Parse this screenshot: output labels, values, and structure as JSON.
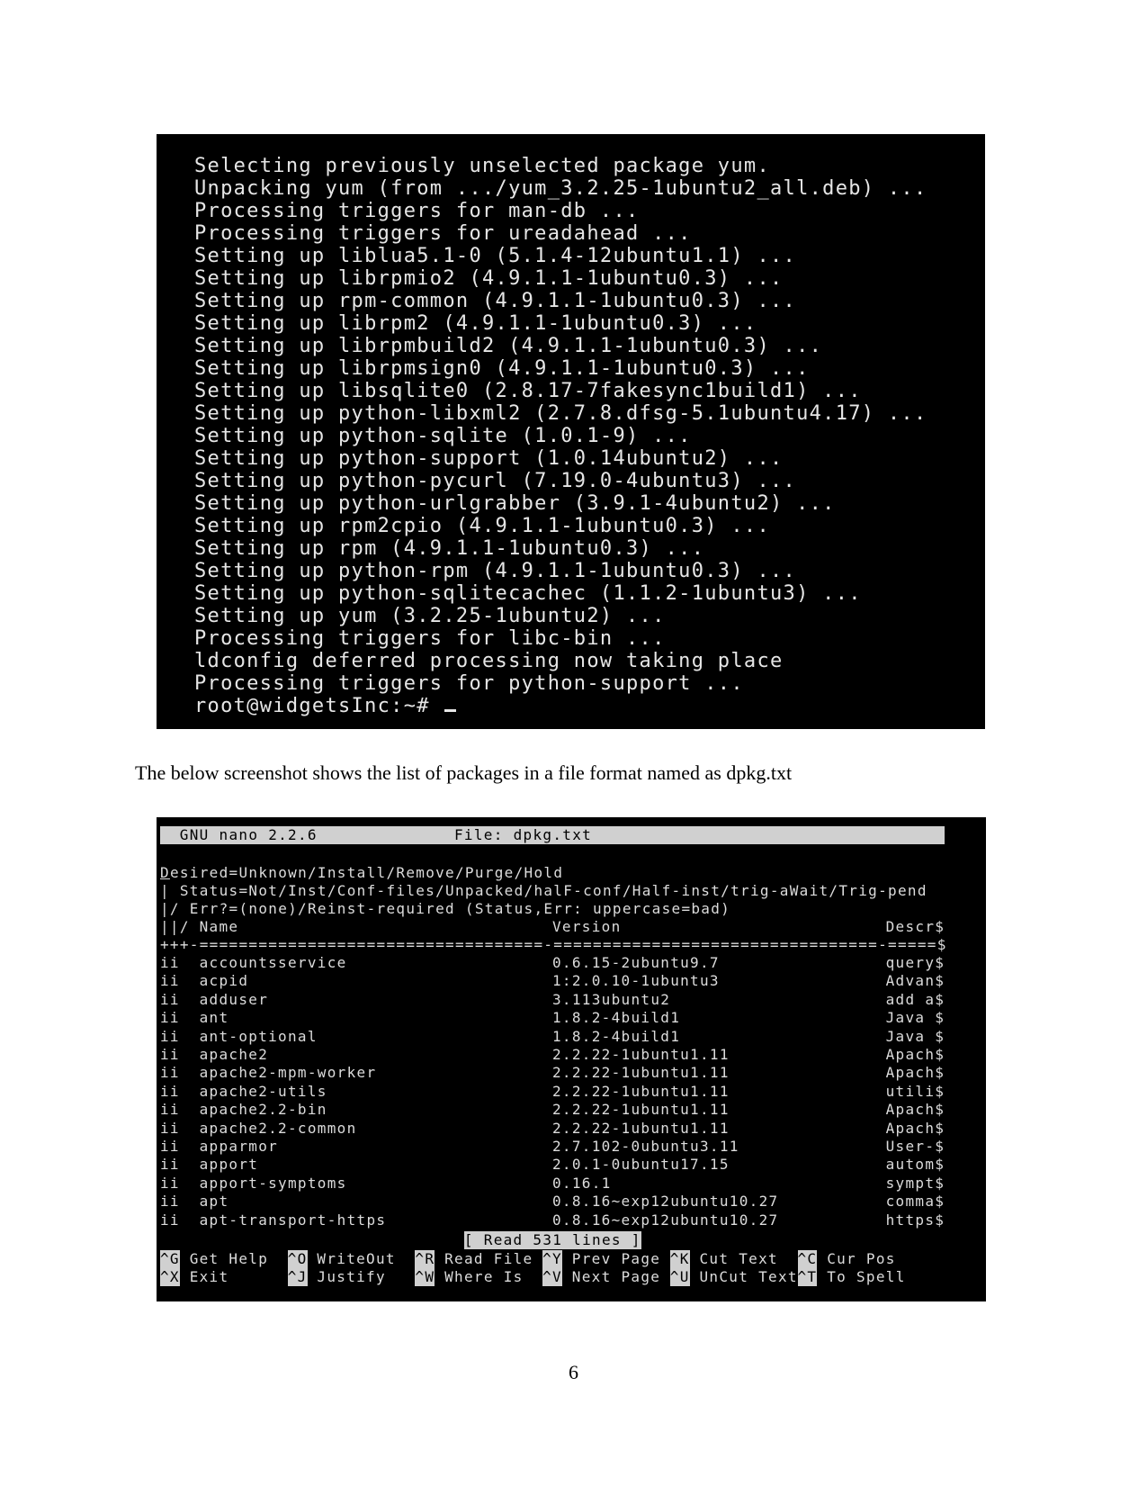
{
  "terminal_output": {
    "lines": [
      "Selecting previously unselected package yum.",
      "Unpacking yum (from .../yum_3.2.25-1ubuntu2_all.deb) ...",
      "Processing triggers for man-db ...",
      "Processing triggers for ureadahead ...",
      "Setting up liblua5.1-0 (5.1.4-12ubuntu1.1) ...",
      "Setting up librpmio2 (4.9.1.1-1ubuntu0.3) ...",
      "Setting up rpm-common (4.9.1.1-1ubuntu0.3) ...",
      "Setting up librpm2 (4.9.1.1-1ubuntu0.3) ...",
      "Setting up librpmbuild2 (4.9.1.1-1ubuntu0.3) ...",
      "Setting up librpmsign0 (4.9.1.1-1ubuntu0.3) ...",
      "Setting up libsqlite0 (2.8.17-7fakesync1build1) ...",
      "Setting up python-libxml2 (2.7.8.dfsg-5.1ubuntu4.17) ...",
      "Setting up python-sqlite (1.0.1-9) ...",
      "Setting up python-support (1.0.14ubuntu2) ...",
      "Setting up python-pycurl (7.19.0-4ubuntu3) ...",
      "Setting up python-urlgrabber (3.9.1-4ubuntu2) ...",
      "Setting up rpm2cpio (4.9.1.1-1ubuntu0.3) ...",
      "Setting up rpm (4.9.1.1-1ubuntu0.3) ...",
      "Setting up python-rpm (4.9.1.1-1ubuntu0.3) ...",
      "Setting up python-sqlitecachec (1.1.2-1ubuntu3) ...",
      "Setting up yum (3.2.25-1ubuntu2) ...",
      "Processing triggers for libc-bin ...",
      "ldconfig deferred processing now taking place",
      "Processing triggers for python-support ..."
    ],
    "prompt": "root@widgetsInc:~# "
  },
  "paragraph": "The below screenshot shows the list of packages in a file format named as dpkg.txt",
  "nano": {
    "app_version": "GNU nano 2.2.6",
    "file_label": "File: dpkg.txt",
    "header": {
      "desired_first": "D",
      "desired_rest": "esired=Unknown/Install/Remove/Purge/Hold",
      "status": "| Status=Not/Inst/Conf-files/Unpacked/halF-conf/Half-inst/trig-aWait/Trig-pend",
      "err": "|/ Err?=(none)/Reinst-required (Status,Err: uppercase=bad)",
      "col_prefix": "||/",
      "col_name": "Name",
      "col_version": "Version",
      "col_descr": "Descr$",
      "separator": "+++-===================================-=================================-=====$"
    },
    "packages": [
      {
        "status": "ii",
        "name": "accountsservice",
        "version": "0.6.15-2ubuntu9.7",
        "descr": "query$"
      },
      {
        "status": "ii",
        "name": "acpid",
        "version": "1:2.0.10-1ubuntu3",
        "descr": "Advan$"
      },
      {
        "status": "ii",
        "name": "adduser",
        "version": "3.113ubuntu2",
        "descr": "add a$"
      },
      {
        "status": "ii",
        "name": "ant",
        "version": "1.8.2-4build1",
        "descr": "Java $"
      },
      {
        "status": "ii",
        "name": "ant-optional",
        "version": "1.8.2-4build1",
        "descr": "Java $"
      },
      {
        "status": "ii",
        "name": "apache2",
        "version": "2.2.22-1ubuntu1.11",
        "descr": "Apach$"
      },
      {
        "status": "ii",
        "name": "apache2-mpm-worker",
        "version": "2.2.22-1ubuntu1.11",
        "descr": "Apach$"
      },
      {
        "status": "ii",
        "name": "apache2-utils",
        "version": "2.2.22-1ubuntu1.11",
        "descr": "utili$"
      },
      {
        "status": "ii",
        "name": "apache2.2-bin",
        "version": "2.2.22-1ubuntu1.11",
        "descr": "Apach$"
      },
      {
        "status": "ii",
        "name": "apache2.2-common",
        "version": "2.2.22-1ubuntu1.11",
        "descr": "Apach$"
      },
      {
        "status": "ii",
        "name": "apparmor",
        "version": "2.7.102-0ubuntu3.11",
        "descr": "User-$"
      },
      {
        "status": "ii",
        "name": "apport",
        "version": "2.0.1-0ubuntu17.15",
        "descr": "autom$"
      },
      {
        "status": "ii",
        "name": "apport-symptoms",
        "version": "0.16.1",
        "descr": "sympt$"
      },
      {
        "status": "ii",
        "name": "apt",
        "version": "0.8.16~exp12ubuntu10.27",
        "descr": "comma$"
      },
      {
        "status": "ii",
        "name": "apt-transport-https",
        "version": "0.8.16~exp12ubuntu10.27",
        "descr": "https$"
      }
    ],
    "status_message": "[ Read 531 lines ]",
    "shortcuts": [
      [
        {
          "key": "^G",
          "label": "Get Help"
        },
        {
          "key": "^O",
          "label": "WriteOut"
        },
        {
          "key": "^R",
          "label": "Read File"
        },
        {
          "key": "^Y",
          "label": "Prev Page"
        },
        {
          "key": "^K",
          "label": "Cut Text"
        },
        {
          "key": "^C",
          "label": "Cur Pos"
        }
      ],
      [
        {
          "key": "^X",
          "label": "Exit"
        },
        {
          "key": "^J",
          "label": "Justify"
        },
        {
          "key": "^W",
          "label": "Where Is"
        },
        {
          "key": "^V",
          "label": "Next Page"
        },
        {
          "key": "^U",
          "label": "UnCut Text"
        },
        {
          "key": "^T",
          "label": "To Spell"
        }
      ]
    ]
  },
  "page_number": "6",
  "colors": {
    "terminal_bg": "#000000",
    "terminal_text": "#e6e6e6",
    "inverse_bg": "#d0d0d0"
  }
}
